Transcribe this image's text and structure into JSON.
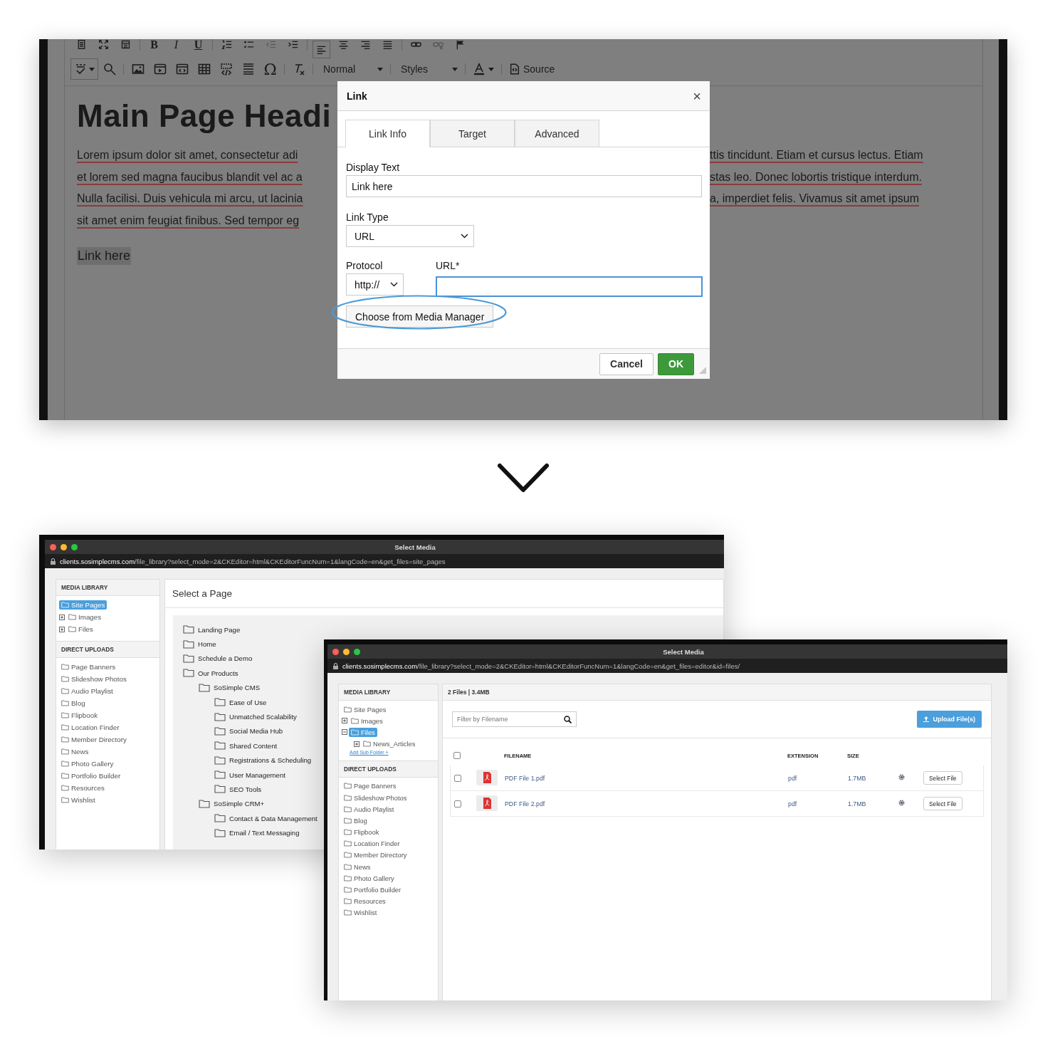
{
  "editor": {
    "toolbar": {
      "row1_glyphs": [
        {
          "text": "B",
          "kind": "bold"
        },
        {
          "text": "I",
          "kind": "italic"
        },
        {
          "text": "U",
          "kind": "underline"
        }
      ],
      "special_char": "Ω",
      "format_dropdown": "Normal",
      "styles_dropdown": "Styles",
      "source_button": "Source"
    },
    "heading": "Main Page Headi",
    "paragraph_lines": [
      {
        "left": "Lorem ipsum dolor sit amet, consectetur adi",
        "right": "ttis tincidunt. Etiam et cursus lectus. Etiam"
      },
      {
        "left": "et lorem sed magna faucibus blandit vel ac a",
        "right": "stas leo. Donec lobortis tristique interdum."
      },
      {
        "left": "Nulla facilisi. Duis vehicula mi arcu, ut lacinia",
        "right": "a, imperdiet felis. Vivamus sit amet ipsum"
      },
      {
        "left": "sit amet enim feugiat finibus. Sed tempor eg"
      }
    ],
    "link_text": "Link here"
  },
  "link_dialog": {
    "title": "Link",
    "close": "×",
    "tabs": [
      {
        "label": "Link Info",
        "selected": true
      },
      {
        "label": "Target",
        "selected": false
      },
      {
        "label": "Advanced",
        "selected": false
      }
    ],
    "display_text": {
      "label": "Display Text",
      "value": "Link here"
    },
    "link_type": {
      "label": "Link Type",
      "value": "URL"
    },
    "protocol": {
      "label": "Protocol",
      "value": "http://"
    },
    "url": {
      "label": "URL",
      "required_mark": "*",
      "focused": true
    },
    "media_button": {
      "label": "Choose from Media Manager",
      "highlighted": true
    },
    "buttons": [
      {
        "label": "Cancel",
        "kind": "secondary"
      },
      {
        "label": "OK",
        "kind": "primary"
      }
    ]
  },
  "windows": [
    {
      "title": "Select Media",
      "url_host": "clients.sosimplecms.com",
      "url_path": "/file_library?select_mode=2&CKEditor=html&CKEditorFuncNum=1&langCode=en&get_files=site_pages",
      "sidebar": {
        "sections": [
          {
            "title": "MEDIA LIBRARY",
            "items": [
              {
                "label": "Site Pages",
                "selected": true
              },
              {
                "label": "Images",
                "selected": false,
                "expanded": false
              },
              {
                "label": "Files",
                "selected": false,
                "expanded": false
              }
            ]
          },
          {
            "title": "DIRECT UPLOADS",
            "items": [
              {
                "label": "Page Banners",
                "selected": false
              },
              {
                "label": "Slideshow Photos",
                "selected": false
              },
              {
                "label": "Audio Playlist",
                "selected": false
              },
              {
                "label": "Blog",
                "selected": false
              },
              {
                "label": "Flipbook",
                "selected": false
              },
              {
                "label": "Location Finder",
                "selected": false
              },
              {
                "label": "Member Directory",
                "selected": false
              },
              {
                "label": "News",
                "selected": false
              },
              {
                "label": "Photo Gallery",
                "selected": false
              },
              {
                "label": "Portfolio Builder",
                "selected": false
              },
              {
                "label": "Resources",
                "selected": false
              },
              {
                "label": "Wishlist",
                "selected": false
              }
            ]
          }
        ]
      },
      "main": {
        "kind": "page_tree",
        "title": "Select a Page",
        "tree": [
          {
            "label": "Landing Page"
          },
          {
            "label": "Home"
          },
          {
            "label": "Schedule a Demo"
          },
          {
            "label": "Our Products",
            "children": [
              {
                "label": "SoSimple CMS",
                "children": [
                  {
                    "label": "Ease of Use"
                  },
                  {
                    "label": "Unmatched Scalability"
                  },
                  {
                    "label": "Social Media Hub"
                  },
                  {
                    "label": "Shared Content"
                  },
                  {
                    "label": "Registrations & Scheduling"
                  },
                  {
                    "label": "User Management"
                  },
                  {
                    "label": "SEO Tools"
                  }
                ]
              },
              {
                "label": "SoSimple CRM+",
                "children": [
                  {
                    "label": "Contact & Data Management"
                  },
                  {
                    "label": "Email / Text Messaging"
                  }
                ]
              }
            ]
          }
        ]
      }
    },
    {
      "title": "Select Media",
      "url_host": "clients.sosimplecms.com",
      "url_path": "/file_library?select_mode=2&CKEditor=html&CKEditorFuncNum=1&langCode=en&get_files=editor&id=files/",
      "sidebar": {
        "sections": [
          {
            "title": "MEDIA LIBRARY",
            "items": [
              {
                "label": "Site Pages",
                "selected": false
              },
              {
                "label": "Images",
                "selected": false,
                "expanded": false
              },
              {
                "label": "Files",
                "selected": true,
                "expanded": true,
                "children": [
                  {
                    "label": "News_Articles",
                    "selected": false,
                    "expanded": false
                  }
                ],
                "add_link": "Add Sub Folder +"
              }
            ]
          },
          {
            "title": "DIRECT UPLOADS",
            "items": [
              {
                "label": "Page Banners",
                "selected": false
              },
              {
                "label": "Slideshow Photos",
                "selected": false
              },
              {
                "label": "Audio Playlist",
                "selected": false
              },
              {
                "label": "Blog",
                "selected": false
              },
              {
                "label": "Flipbook",
                "selected": false
              },
              {
                "label": "Location Finder",
                "selected": false
              },
              {
                "label": "Member Directory",
                "selected": false
              },
              {
                "label": "News",
                "selected": false
              },
              {
                "label": "Photo Gallery",
                "selected": false
              },
              {
                "label": "Portfolio Builder",
                "selected": false
              },
              {
                "label": "Resources",
                "selected": false
              },
              {
                "label": "Wishlist",
                "selected": false
              }
            ]
          }
        ]
      },
      "main": {
        "kind": "file_list",
        "summary": "2 Files | 3.4MB",
        "filter_placeholder": "Filter by Filename",
        "upload_button": "Upload File(s)",
        "select_all_checked": false,
        "columns": [
          "FILENAME",
          "EXTENSION",
          "SIZE"
        ],
        "rows": [
          {
            "checked": false,
            "filename": "PDF File 1.pdf",
            "extension": "pdf",
            "size": "1.7MB",
            "action": "Select File"
          },
          {
            "checked": false,
            "filename": "PDF File 2.pdf",
            "extension": "pdf",
            "size": "1.7MB",
            "action": "Select File"
          }
        ]
      }
    }
  ]
}
